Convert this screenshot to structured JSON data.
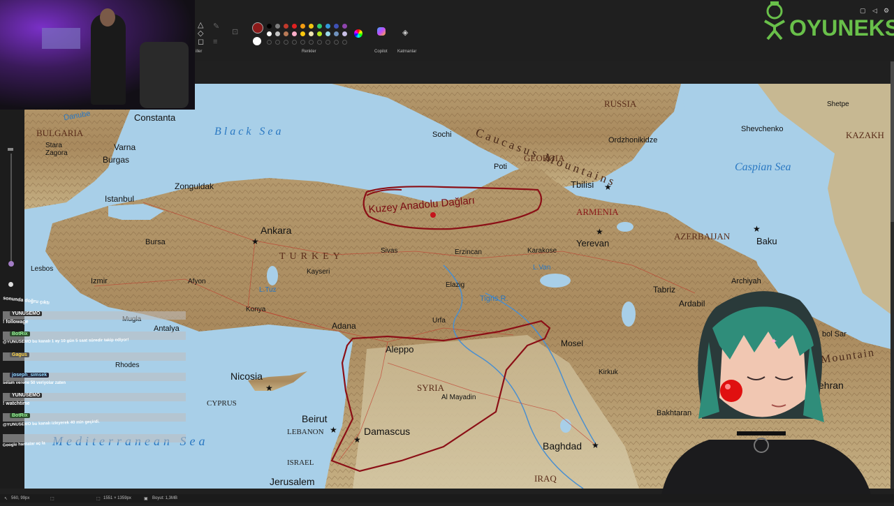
{
  "toolbar": {
    "colors_label": "Renkler",
    "copilot_label": "Copilot",
    "layers_label": "Katmanlar",
    "tools_label_partial": "iller",
    "palette_row1": [
      "#000000",
      "#7f7f7f",
      "#c0392b",
      "#e02020",
      "#f39c12",
      "#f1c40f",
      "#2ecc71",
      "#3498db",
      "#3f51b5",
      "#8e44ad"
    ],
    "palette_row2": [
      "#ffffff",
      "#c3c3c3",
      "#b97a57",
      "#ffaec9",
      "#ffc90e",
      "#efe4b0",
      "#b5e61d",
      "#99d9ea",
      "#7092be",
      "#c8bfe7"
    ],
    "active_color": "#8b1a1a"
  },
  "logo": {
    "text": "OYUNEKS",
    "color": "#69c04a"
  },
  "statusbar": {
    "cursor_pos": "560, 99px",
    "canvas_size": "1551 × 1359px",
    "file_size": "Boyut: 1,3MB"
  },
  "map": {
    "seas": {
      "black_sea": "Black Sea",
      "caspian_sea": "Caspian Sea",
      "mediterranean_sea": "Mediterranean Sea"
    },
    "countries": {
      "russia": "RUSSIA",
      "georgia": "GEORGIA",
      "armenia": "ARMENIA",
      "azerbaijan": "AZERBAIJAN",
      "turkey": "TURKEY",
      "syria": "SYRIA",
      "bulgaria": "BULGARIA",
      "cyprus": "CYPRUS",
      "lebanon": "LEBANON",
      "israel": "ISRAEL",
      "iraq": "IRAQ",
      "kazakh": "KAZAKH"
    },
    "cities": {
      "constanta": "Constanta",
      "varna": "Varna",
      "stara_zagora": "Stara Zagora",
      "burgas": "Burgas",
      "zonguldak": "Zonguldak",
      "istanbul": "Istanbul",
      "bursa": "Bursa",
      "ankara": "Ankara",
      "lesbos": "Lesbos",
      "izmir": "Izmir",
      "afyon": "Afyon",
      "konya": "Konya",
      "kayseri": "Kayseri",
      "sivas": "Sivas",
      "erzincan": "Erzincan",
      "karakose": "Karakose",
      "yerevan": "Yerevan",
      "tbilisi": "Tbilisi",
      "poti": "Poti",
      "sochi": "Sochi",
      "ordzhonikidze": "Ordzhonikidze",
      "baku": "Baku",
      "shevchenko": "Shevchenko",
      "shetpe": "Shetpe",
      "elazig": "Elazig",
      "urfa": "Urfa",
      "adana": "Adana",
      "antalya": "Antalya",
      "mugla": "Mugla",
      "rhodes": "Rhodes",
      "aleppo": "Aleppo",
      "al_mayadin": "Al Mayadin",
      "mosel": "Mosel",
      "kirkuk": "Kirkuk",
      "nicosia": "Nicosia",
      "beirut": "Beirut",
      "damascus": "Damascus",
      "baghdad": "Baghdad",
      "jerusalem": "Jerusalem",
      "tabriz": "Tabriz",
      "ardabil": "Ardabil",
      "archiyah": "Archiyah",
      "bakhtaran": "Bakhtaran",
      "tehran_partial": "ehran",
      "babol_sar_partial": "bol Sar"
    },
    "features": {
      "caucasus_mountains": "Caucasus Mountains",
      "mountains_partial": "Mountain",
      "l_tuz": "L.Tuz",
      "l_van": "L.Van",
      "tigris": "Tigris R.",
      "danube": "Danube"
    },
    "annotation": "Kuzey Anadolu Dağları",
    "annotation_color": "#8b0f16"
  },
  "chat": {
    "messages": [
      {
        "user": "",
        "text": "sonunda doğru çıktı"
      },
      {
        "user": "YUNUSEMO",
        "text": ""
      },
      {
        "user": "",
        "text": "! followage"
      },
      {
        "user": "BotRix",
        "text": ""
      },
      {
        "user": "",
        "text": "@YUNUSEMO bu kanalı 1 ay 10 gün 5 saat süredir takip ediyor!"
      },
      {
        "user": "Gagus",
        "text": ""
      },
      {
        "user": "joseph_simsek",
        "text": ""
      },
      {
        "user": "",
        "text": "selam verene 50 veriyolar zaten"
      },
      {
        "user": "YUNUSEMO",
        "text": ""
      },
      {
        "user": "",
        "text": "! watchtime"
      },
      {
        "user": "BotRix",
        "text": ""
      },
      {
        "user": "",
        "text": "@YUNUSEMO bu kanalı izleyerek 40 min geçirdi."
      },
      {
        "user": "",
        "text": "Google haritalar aç la"
      }
    ]
  }
}
